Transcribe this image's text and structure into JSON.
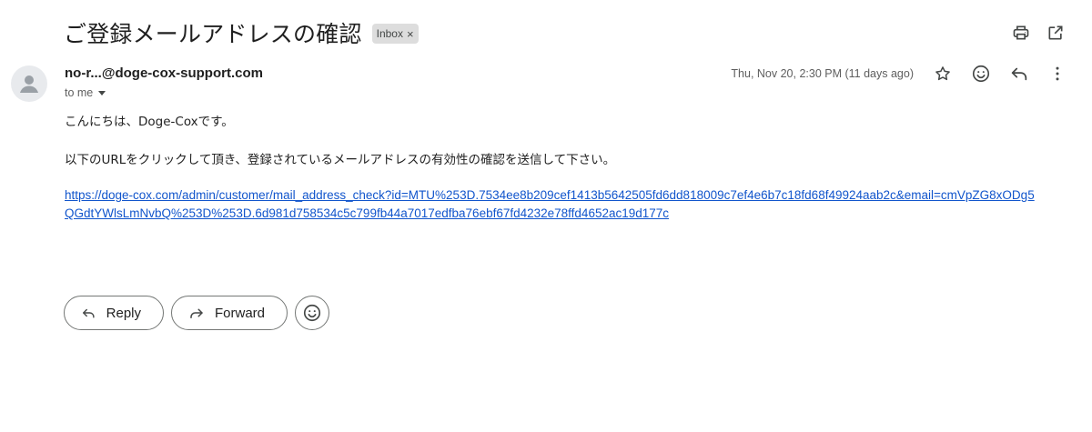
{
  "subject": "ご登録メールアドレスの確認",
  "label": {
    "name": "Inbox",
    "remove": "×"
  },
  "header_icons": [
    "print-icon",
    "open-in-new-window-icon"
  ],
  "sender": {
    "address": "no-r...@doge-cox-support.com",
    "recipient": "to me",
    "timestamp": "Thu, Nov 20, 2:30 PM (11 days ago)"
  },
  "message_icons": [
    "star-icon",
    "emoji-reaction-icon",
    "reply-icon",
    "more-vertical-icon"
  ],
  "body": {
    "greeting": "こんにちは、Doge-Coxです。",
    "instruction": "以下のURLをクリックして頂き、登録されているメールアドレスの有効性の確認を送信して下さい。",
    "link": "https://doge-cox.com/admin/customer/mail_address_check?id=MTU%253D.7534ee8b209cef1413b5642505fd6dd818009c7ef4e6b7c18fd68f49924aab2c&email=cmVpZG8xODg5QGdtYWlsLmNvbQ%253D%253D.6d981d758534c5c799fb44a7017edfba76ebf67fd4232e78ffd4652ac19d177c"
  },
  "actions": {
    "reply": "Reply",
    "forward": "Forward"
  },
  "colors": {
    "link": "#1155cc",
    "chip_bg": "#dddddd",
    "border": "#747775"
  }
}
